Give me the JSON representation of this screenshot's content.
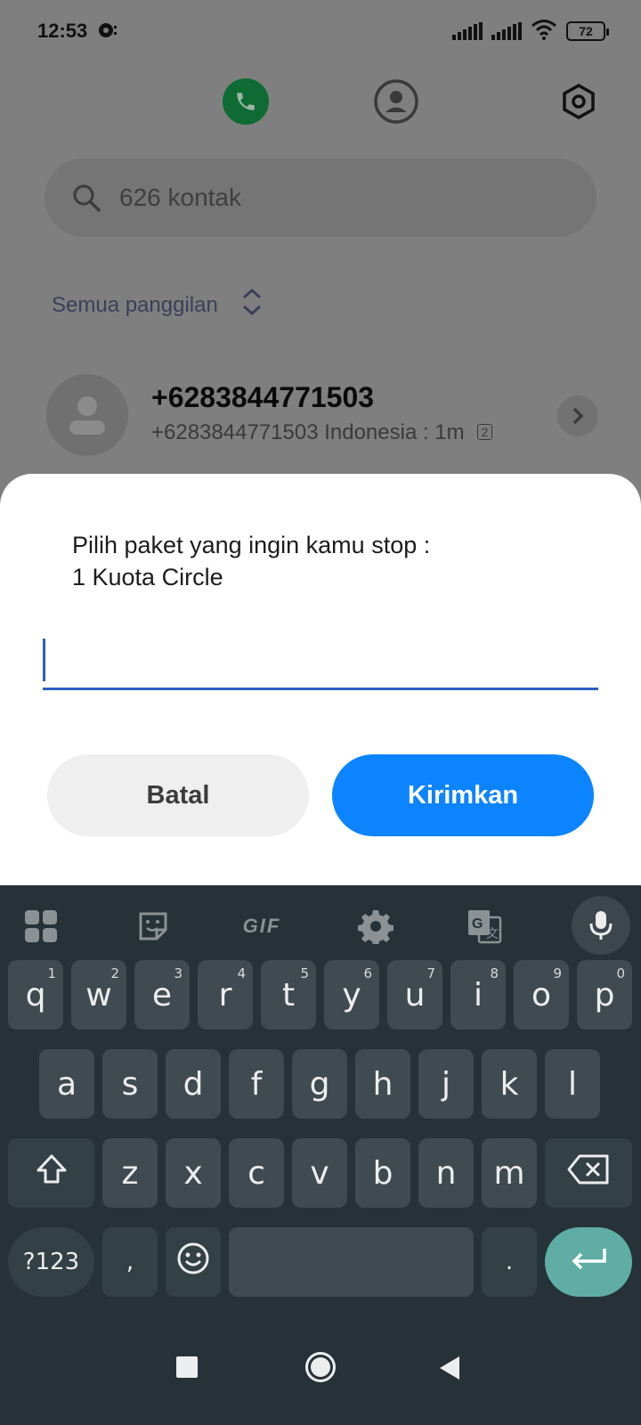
{
  "status_bar": {
    "time": "12:53",
    "battery": "72"
  },
  "dialer": {
    "search_placeholder": "626 kontak",
    "filter_label": "Semua panggilan",
    "recent_call": {
      "name": "+6283844771503",
      "detail": "+6283844771503 Indonesia  : 1m",
      "sim": "2"
    }
  },
  "dialog": {
    "message_line1": "Pilih paket yang ingin kamu stop :",
    "message_line2": "1 Kuota Circle",
    "input_value": "",
    "cancel_label": "Batal",
    "send_label": "Kirimkan"
  },
  "keyboard": {
    "toolbar": {
      "gif_label": "GIF",
      "items": [
        "apps-grid-icon",
        "sticker-icon",
        "gif-icon",
        "settings-icon",
        "translate-icon",
        "microphone-icon"
      ]
    },
    "row1": [
      {
        "key": "q",
        "hint": "1"
      },
      {
        "key": "w",
        "hint": "2"
      },
      {
        "key": "e",
        "hint": "3"
      },
      {
        "key": "r",
        "hint": "4"
      },
      {
        "key": "t",
        "hint": "5"
      },
      {
        "key": "y",
        "hint": "6"
      },
      {
        "key": "u",
        "hint": "7"
      },
      {
        "key": "i",
        "hint": "8"
      },
      {
        "key": "o",
        "hint": "9"
      },
      {
        "key": "p",
        "hint": "0"
      }
    ],
    "row2": [
      "a",
      "s",
      "d",
      "f",
      "g",
      "h",
      "j",
      "k",
      "l"
    ],
    "row3": [
      "z",
      "x",
      "c",
      "v",
      "b",
      "n",
      "m"
    ],
    "symbols_label": "?123",
    "comma_label": ",",
    "period_label": "."
  },
  "colors": {
    "accent_blue": "#0c84ff",
    "input_underline": "#2f5ec2",
    "keyboard_bg": "#263238",
    "key_bg": "#3f4b51",
    "enter_key": "#5fada4",
    "phone_tab": "#0d6b33"
  }
}
